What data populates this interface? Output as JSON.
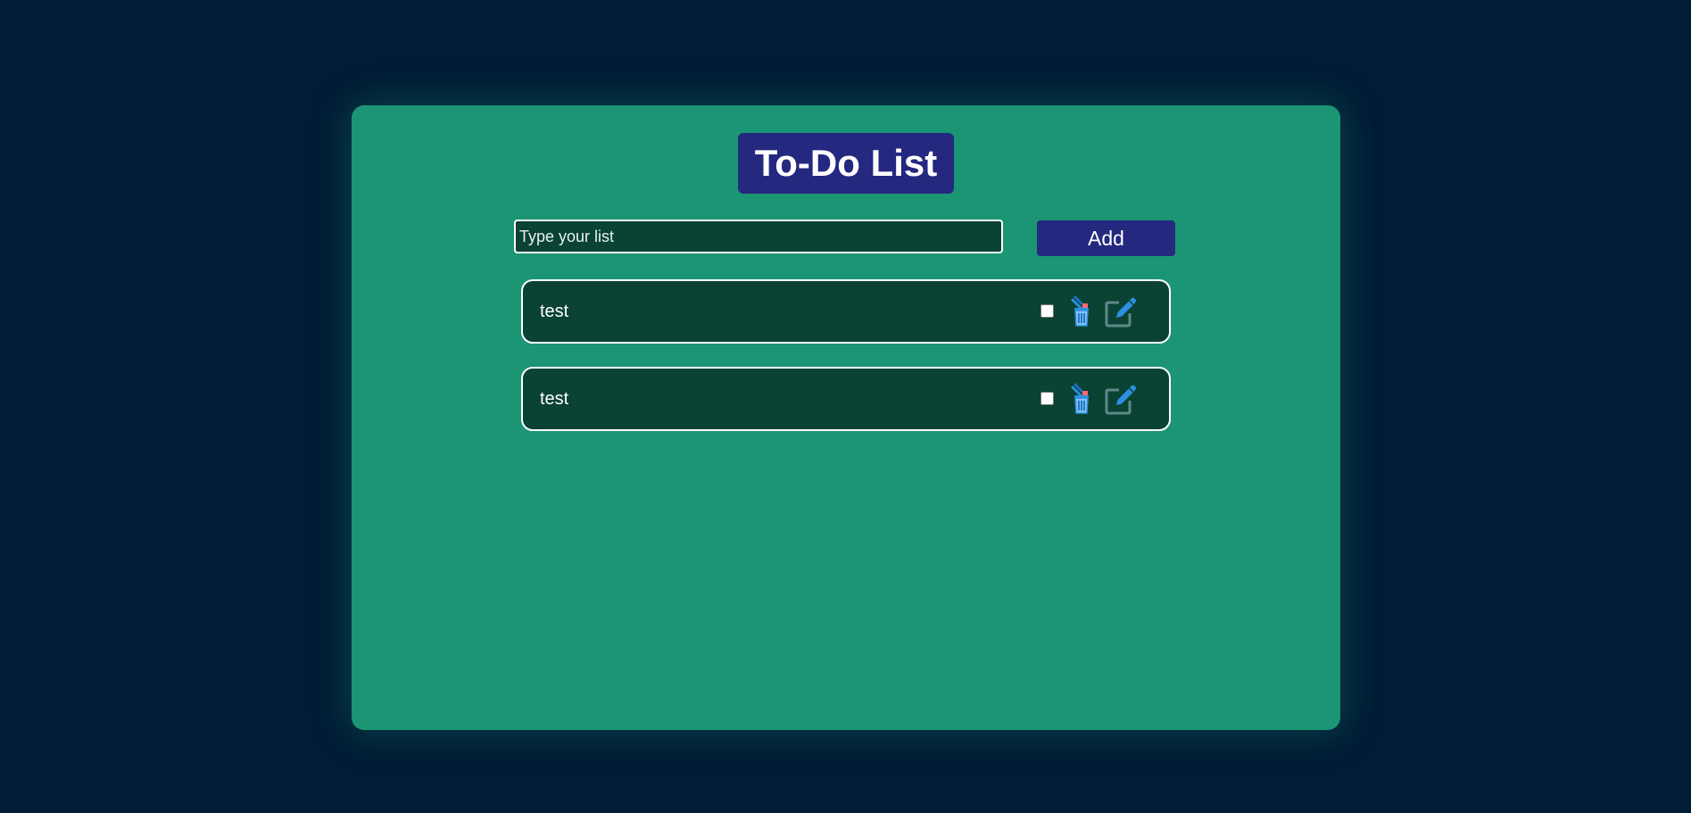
{
  "app": {
    "title": "To-Do List"
  },
  "input": {
    "placeholder": "Type your list",
    "value": ""
  },
  "add_button": {
    "label": "Add"
  },
  "todos": [
    {
      "text": "test",
      "checked": false,
      "delete_icon": "trash-icon",
      "edit_icon": "edit-icon"
    },
    {
      "text": "test",
      "checked": false,
      "delete_icon": "trash-icon",
      "edit_icon": "edit-icon"
    }
  ],
  "colors": {
    "background": "#011c35",
    "card": "#1c9574",
    "accent": "#25287f",
    "item": "#0a4233",
    "icon_blue": "#2d8fe0"
  }
}
